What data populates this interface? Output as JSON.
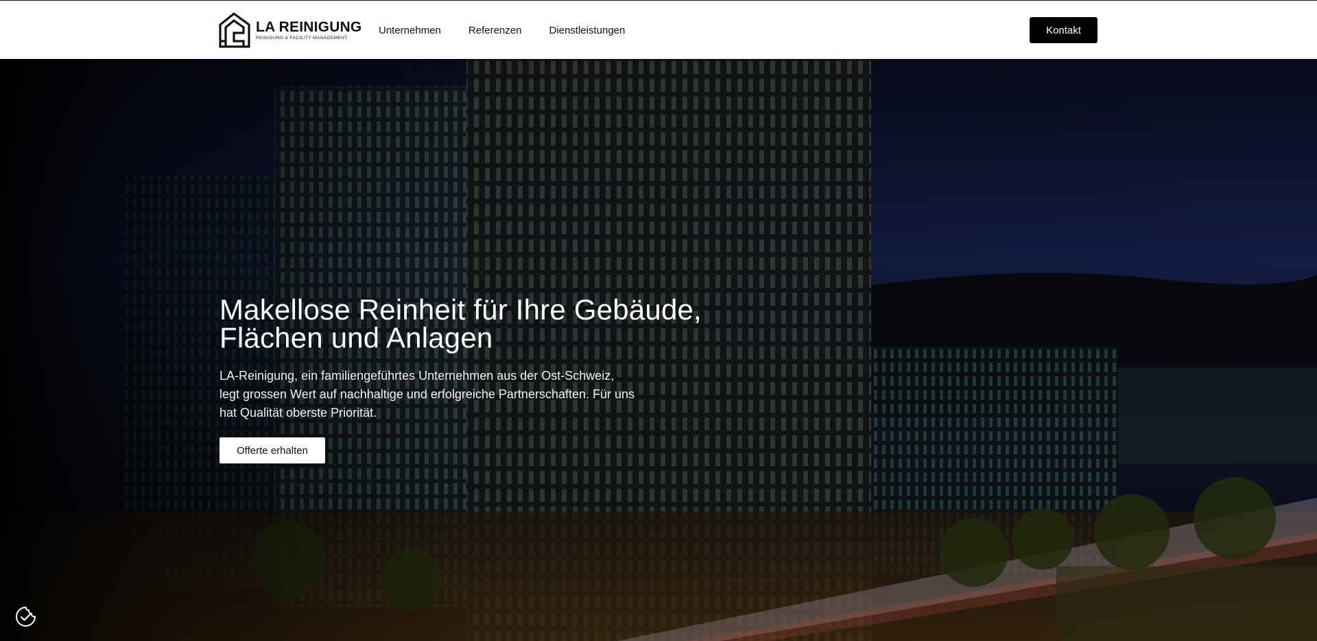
{
  "header": {
    "logo": {
      "title": "LA REINIGUNG",
      "subtitle": "REINIGUNG & FACILITY MANAGEMENT",
      "icon": "building-logo-icon"
    },
    "nav": [
      {
        "label": "Unternehmen"
      },
      {
        "label": "Referenzen"
      },
      {
        "label": "Dienstleistungen"
      }
    ],
    "contact_label": "Kontakt"
  },
  "hero": {
    "title_line1": "Makellose Reinheit für Ihre Gebäude,",
    "title_line2": "Flächen und Anlagen",
    "desc_line1": "LA-Reinigung, ein familiengeführtes Unternehmen aus der Ost-Schweiz,",
    "desc_line2": "legt grossen Wert auf nachhaltige und erfolgreiche Partnerschaften. Für uns",
    "desc_line3": "hat Qualität oberste Priorität.",
    "cta_label": "Offerte erhalten",
    "background": "night-city-office-towers-image"
  },
  "cookie": {
    "icon": "cookie-consent-icon"
  },
  "colors": {
    "header_bg": "#ffffff",
    "primary_button": "#000000",
    "text_dark": "#111111"
  }
}
